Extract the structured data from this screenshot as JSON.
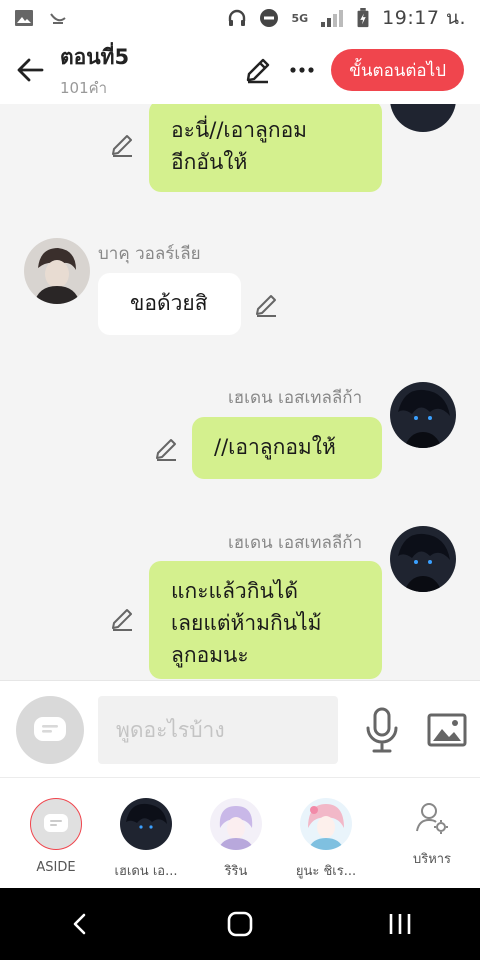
{
  "status_bar": {
    "network": "5G",
    "time": "19:17 น."
  },
  "header": {
    "title": "ตอนที่5",
    "word_count": "101คำ",
    "next_button": "ขั้นตอนต่อไป",
    "accent_color": "#f0454d"
  },
  "messages": [
    {
      "side": "right",
      "sender": "",
      "lines": [
        "อะนี่//เอาลูกอม",
        "อีกอันให้"
      ]
    },
    {
      "side": "left",
      "sender": "บาคุ วอลร์เลีย",
      "lines": [
        "ขอด้วยสิ"
      ]
    },
    {
      "side": "right",
      "sender": "เฮเดน เอสเทลลีก้า",
      "lines": [
        "//เอาลูกอมให้"
      ]
    },
    {
      "side": "right",
      "sender": "เฮเดน เอสเทลลีก้า",
      "lines": [
        "แกะแล้วกินได้",
        "เลยแต่ห้ามกินไม้",
        "ลูกอมนะ"
      ]
    }
  ],
  "composer": {
    "placeholder": "พูดอะไรบ้าง"
  },
  "characters": [
    {
      "label": "ASIDE",
      "icon": "aside-chat-icon"
    },
    {
      "label": "เฮเดน เอ..."
    },
    {
      "label": "ริริน"
    },
    {
      "label": "ยูนะ ชิเร..."
    },
    {
      "label": "บริหาร",
      "icon": "user-settings-icon"
    }
  ],
  "colors": {
    "right_bubble": "#d4f08e",
    "left_bubble": "#ffffff",
    "background": "#f4f4f4"
  }
}
